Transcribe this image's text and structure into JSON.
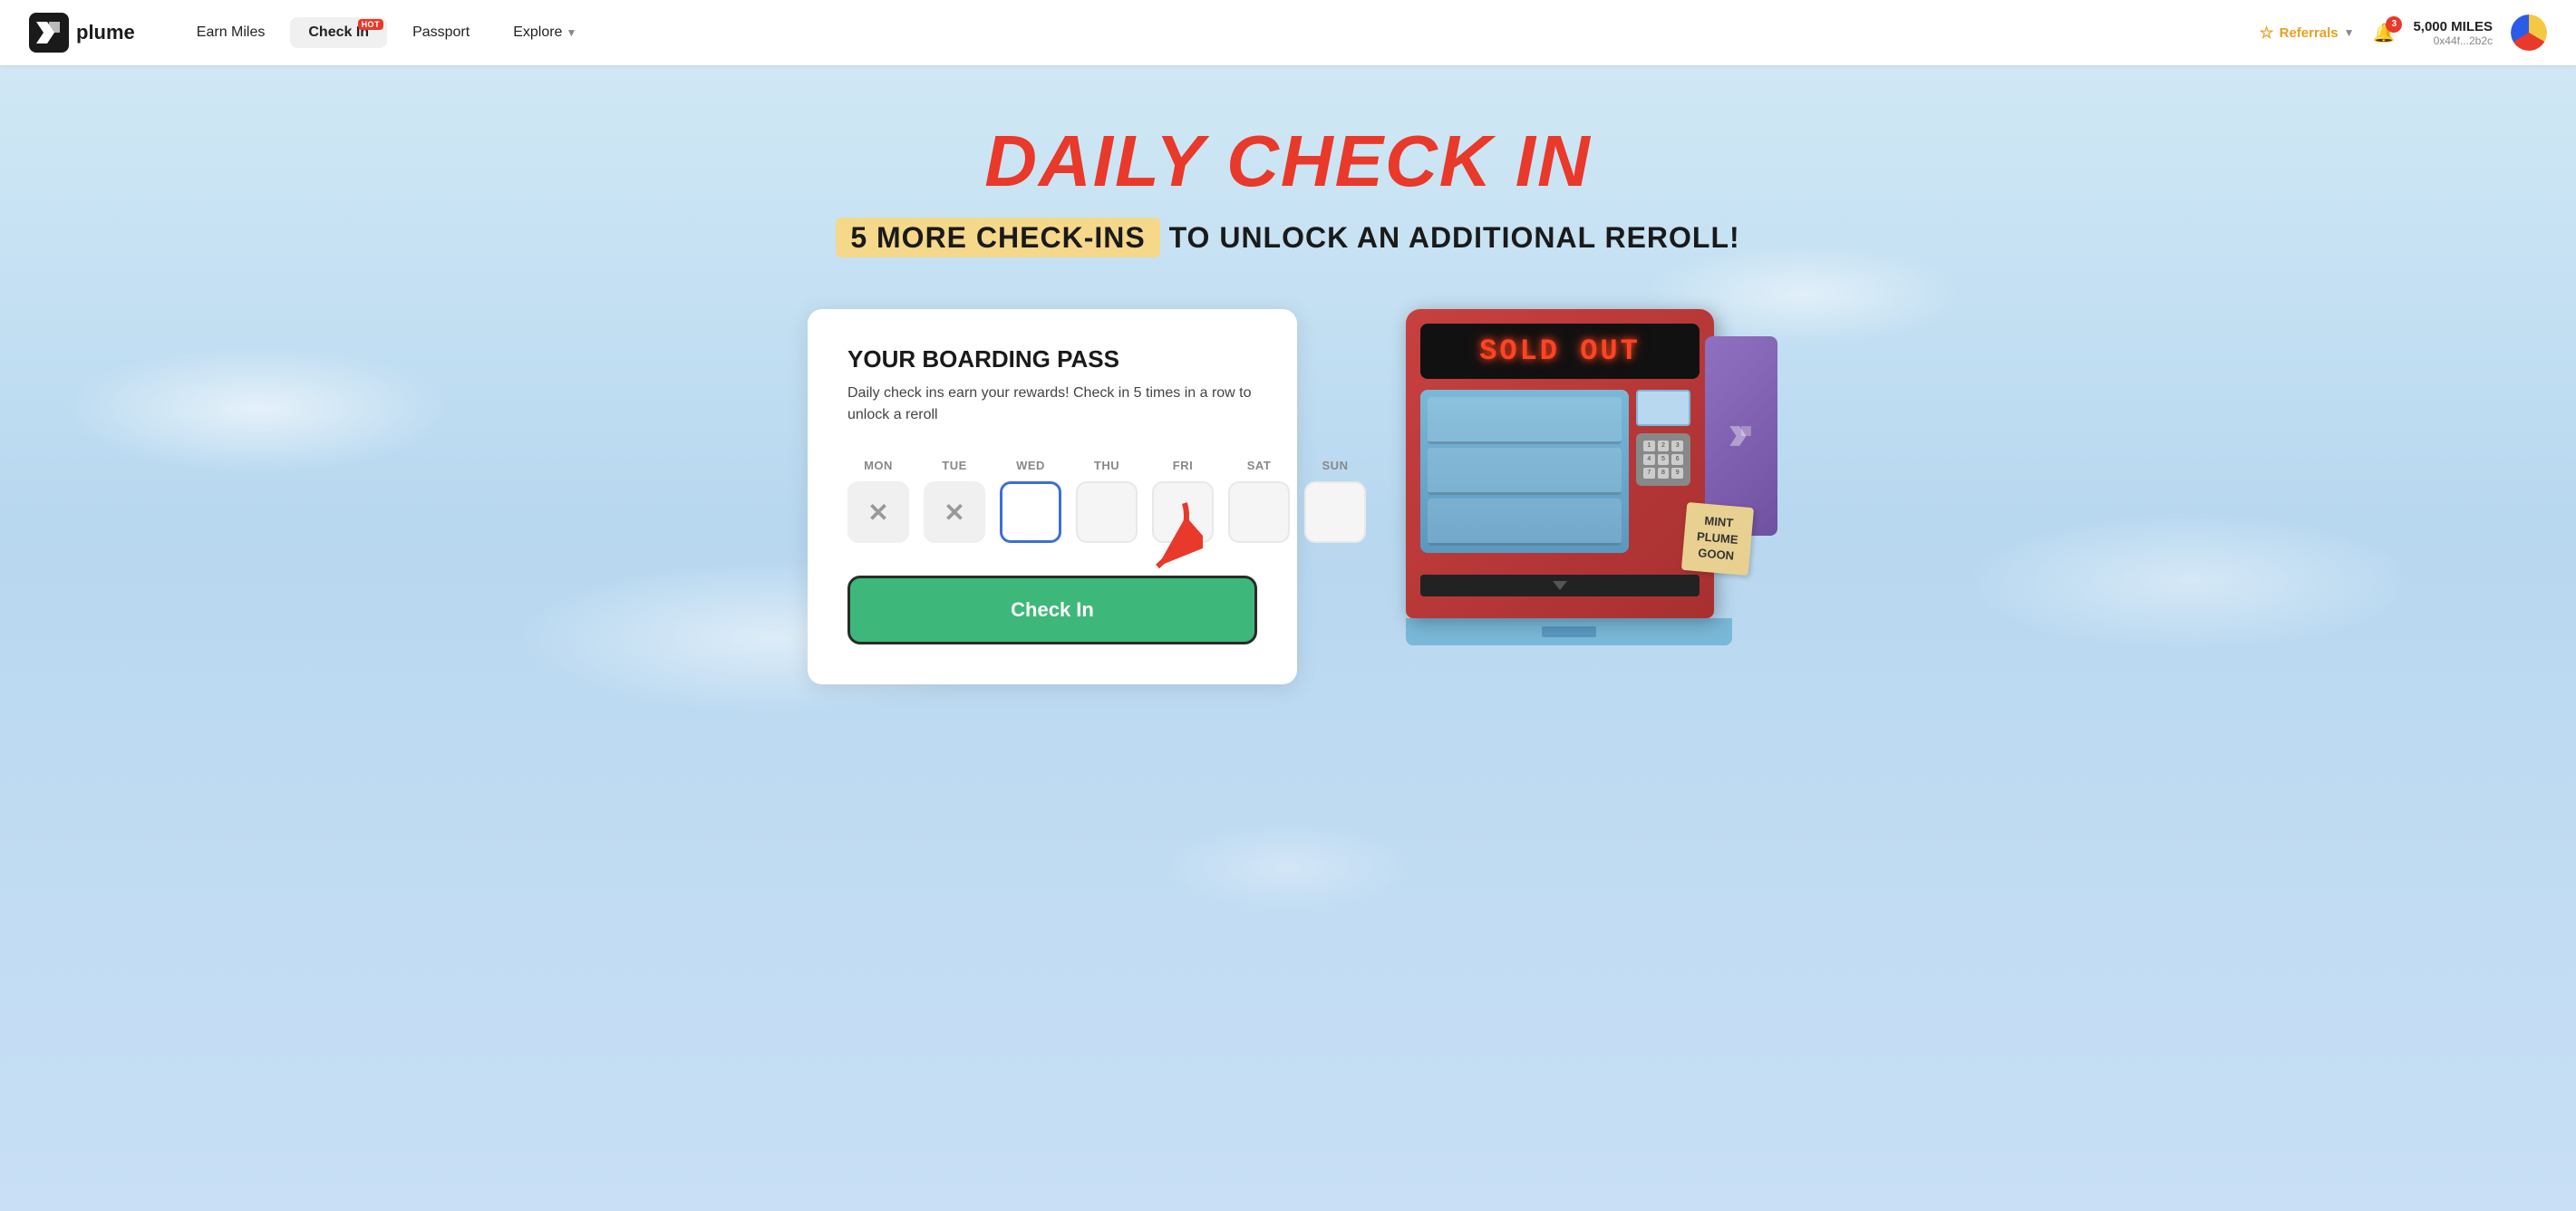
{
  "nav": {
    "logo_text": "plume",
    "earn_miles_label": "Earn Miles",
    "checkin_label": "Check In",
    "checkin_hot_badge": "HOT",
    "passport_label": "Passport",
    "explore_label": "Explore",
    "referrals_label": "Referrals",
    "miles_amount": "5,000 MILES",
    "wallet_address": "0x44f...2b2c",
    "notification_count": "3"
  },
  "hero": {
    "title": "DAILY CHECK IN",
    "subtitle_highlight": "5 MORE CHECK-INS",
    "subtitle_rest": " TO UNLOCK AN ADDITIONAL REROLL!"
  },
  "boarding_pass": {
    "title": "YOUR BOARDING PASS",
    "description": "Daily check ins earn your rewards! Check in 5 times in a row to unlock a reroll",
    "days": [
      {
        "label": "MON",
        "state": "checked"
      },
      {
        "label": "TUE",
        "state": "checked"
      },
      {
        "label": "WED",
        "state": "today"
      },
      {
        "label": "THU",
        "state": "empty"
      },
      {
        "label": "FRI",
        "state": "empty"
      },
      {
        "label": "SAT",
        "state": "empty"
      },
      {
        "label": "SUN",
        "state": "empty"
      }
    ],
    "checkin_button_label": "Check In"
  },
  "vending_machine": {
    "sold_out_text": "SOLD OUT",
    "sticky_lines": [
      "MINT",
      "PLUME",
      "GOON"
    ]
  }
}
